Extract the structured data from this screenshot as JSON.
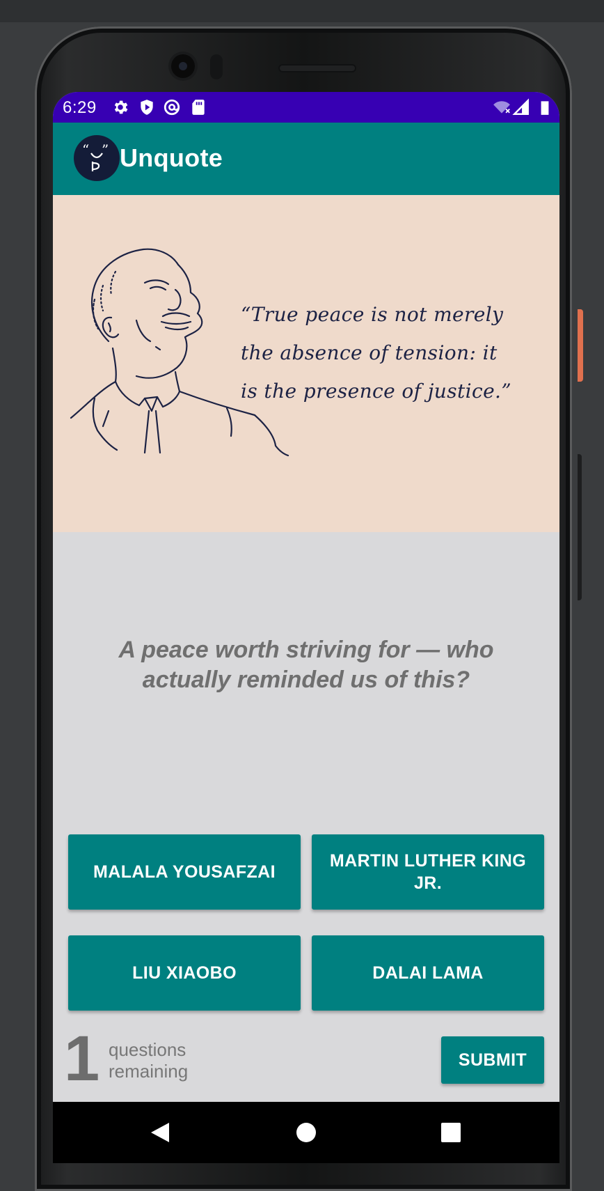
{
  "status_bar": {
    "time": "6:29",
    "icons": [
      "gear-icon",
      "shield-icon",
      "at-sign-icon",
      "sd-card-icon",
      "wifi-off-icon",
      "signal-icon",
      "battery-icon"
    ]
  },
  "app_bar": {
    "title": "Unquote",
    "logo_icon": "unquote-logo-icon"
  },
  "quote": {
    "lines": [
      "“True peace is not merely",
      "the absence of tension: it",
      "is the presence of justice.”"
    ],
    "illustration": "portrait-sketch-icon"
  },
  "question": {
    "text": "A peace worth striving for — who actually reminded us of this?"
  },
  "answers": [
    {
      "label": "MALALA YOUSAFZAI"
    },
    {
      "label": "MARTIN LUTHER KING JR."
    },
    {
      "label": "LIU XIAOBO"
    },
    {
      "label": "DALAI LAMA"
    }
  ],
  "footer": {
    "remaining_count": "1",
    "remaining_label": "questions remaining",
    "submit_label": "SUBMIT"
  },
  "colors": {
    "status_bar": "#3700b3",
    "primary": "#008080",
    "quote_background": "#efdacb",
    "screen_background": "#d9d9db",
    "ink": "#1c2244"
  }
}
